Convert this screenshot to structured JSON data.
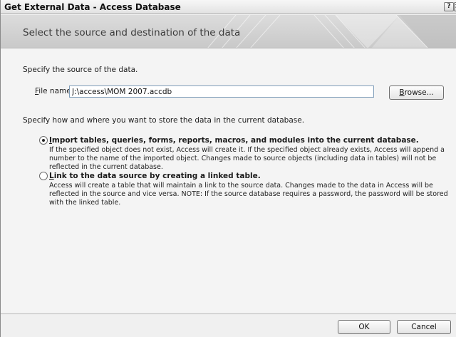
{
  "window": {
    "title": "Get External Data - Access Database",
    "help_glyph": "?",
    "close_glyph": "×"
  },
  "header": {
    "title": "Select the source and destination of the data"
  },
  "source": {
    "heading": "Specify the source of the data.",
    "file_label_prefix": "F",
    "file_label_rest": "ile name:",
    "file_value": "J:\\access\\MOM 2007.accdb",
    "browse_prefix": "B",
    "browse_rest": "rowse..."
  },
  "destination": {
    "heading": "Specify how and where you want to store the data in the current database.",
    "options": [
      {
        "title_prefix": "I",
        "title_rest": "mport tables, queries, forms, reports, macros, and modules into the current database.",
        "desc": "If the specified object does not exist, Access will create it. If the specified object already exists, Access will append a number to the name of the imported object. Changes made to source objects (including data in tables) will not be reflected in the current database.",
        "selected": true
      },
      {
        "title_prefix": "L",
        "title_rest": "ink to the data source by creating a linked table.",
        "desc": "Access will create a table that will maintain a link to the source data. Changes made to the data in Access will be reflected in the source and vice versa. NOTE:  If the source database requires a password, the password will be stored with the linked table.",
        "selected": false
      }
    ]
  },
  "footer": {
    "ok_label": "OK",
    "cancel_label": "Cancel"
  }
}
